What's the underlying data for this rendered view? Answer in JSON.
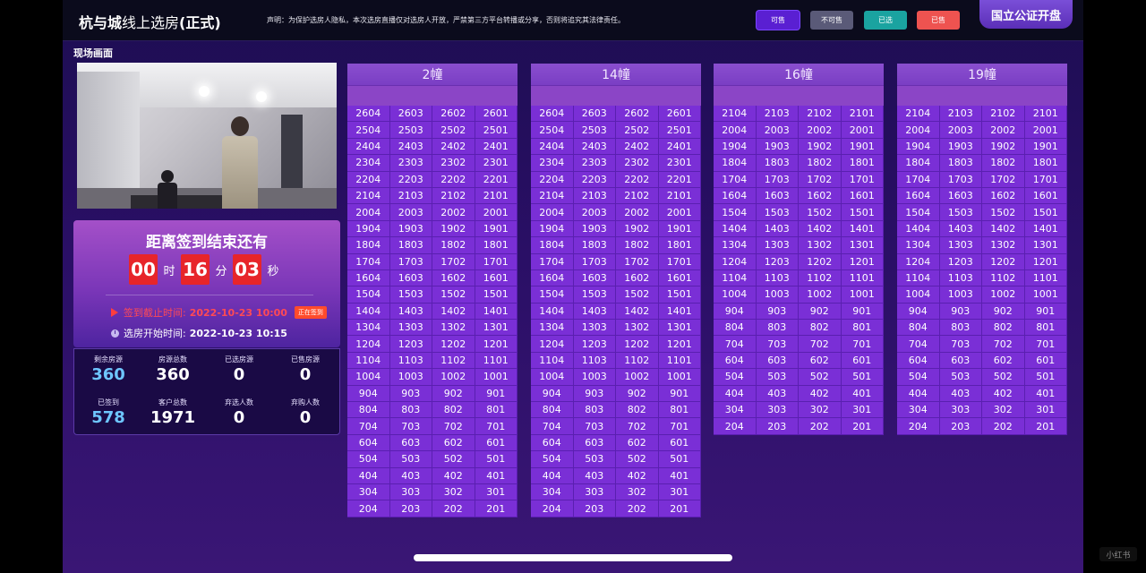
{
  "header": {
    "title_bold": "杭与城",
    "title_thin": "线上选房",
    "title_suffix": "(正式)",
    "notice": "声明：为保护选房人隐私，本次选房直播仅对选房人开放，严禁第三方平台转播或分享，否则将追究其法律责任。",
    "legend": {
      "available": "可售",
      "unavailable": "不可售",
      "chosen": "已选",
      "sold": "已售"
    },
    "right_tab": "国立公证开盘"
  },
  "live_label": "现场画面",
  "countdown": {
    "title": "距离签到结束还有",
    "hours": "00",
    "hours_unit": "时",
    "minutes": "16",
    "minutes_unit": "分",
    "seconds": "03",
    "seconds_unit": "秒",
    "deadline_label": "签到截止时间:",
    "deadline_value": "2022-10-23 10:00",
    "deadline_badge": "正在签到",
    "start_label": "选房开始时间:",
    "start_value": "2022-10-23 10:15"
  },
  "stats": [
    {
      "label": "剩余房源",
      "value": "360",
      "highlight": true
    },
    {
      "label": "房源总数",
      "value": "360",
      "highlight": false
    },
    {
      "label": "已选房源",
      "value": "0",
      "highlight": false
    },
    {
      "label": "已售房源",
      "value": "0",
      "highlight": false
    },
    {
      "label": "已签到",
      "value": "578",
      "highlight": true
    },
    {
      "label": "客户总数",
      "value": "1971",
      "highlight": false
    },
    {
      "label": "弃选人数",
      "value": "0",
      "highlight": false
    },
    {
      "label": "弃购人数",
      "value": "0",
      "highlight": false
    }
  ],
  "buildings": [
    {
      "name": "2幢",
      "floors": [
        26,
        25,
        24,
        23,
        22,
        21,
        20,
        19,
        18,
        17,
        16,
        15,
        14,
        13,
        12,
        11,
        10,
        9,
        8,
        7,
        6,
        5,
        4,
        3,
        2
      ]
    },
    {
      "name": "14幢",
      "floors": [
        26,
        25,
        24,
        23,
        22,
        21,
        20,
        19,
        18,
        17,
        16,
        15,
        14,
        13,
        12,
        11,
        10,
        9,
        8,
        7,
        6,
        5,
        4,
        3,
        2
      ]
    },
    {
      "name": "16幢",
      "floors": [
        21,
        20,
        19,
        18,
        17,
        16,
        15,
        14,
        13,
        12,
        11,
        10,
        9,
        8,
        7,
        6,
        5,
        4,
        3,
        2
      ]
    },
    {
      "name": "19幢",
      "floors": [
        21,
        20,
        19,
        18,
        17,
        16,
        15,
        14,
        13,
        12,
        11,
        10,
        9,
        8,
        7,
        6,
        5,
        4,
        3,
        2
      ]
    }
  ],
  "colors": {
    "available": "#7a2fd6",
    "accent": "#a450c8",
    "countdown_box": "#e7252a"
  },
  "watermark": "小红书"
}
